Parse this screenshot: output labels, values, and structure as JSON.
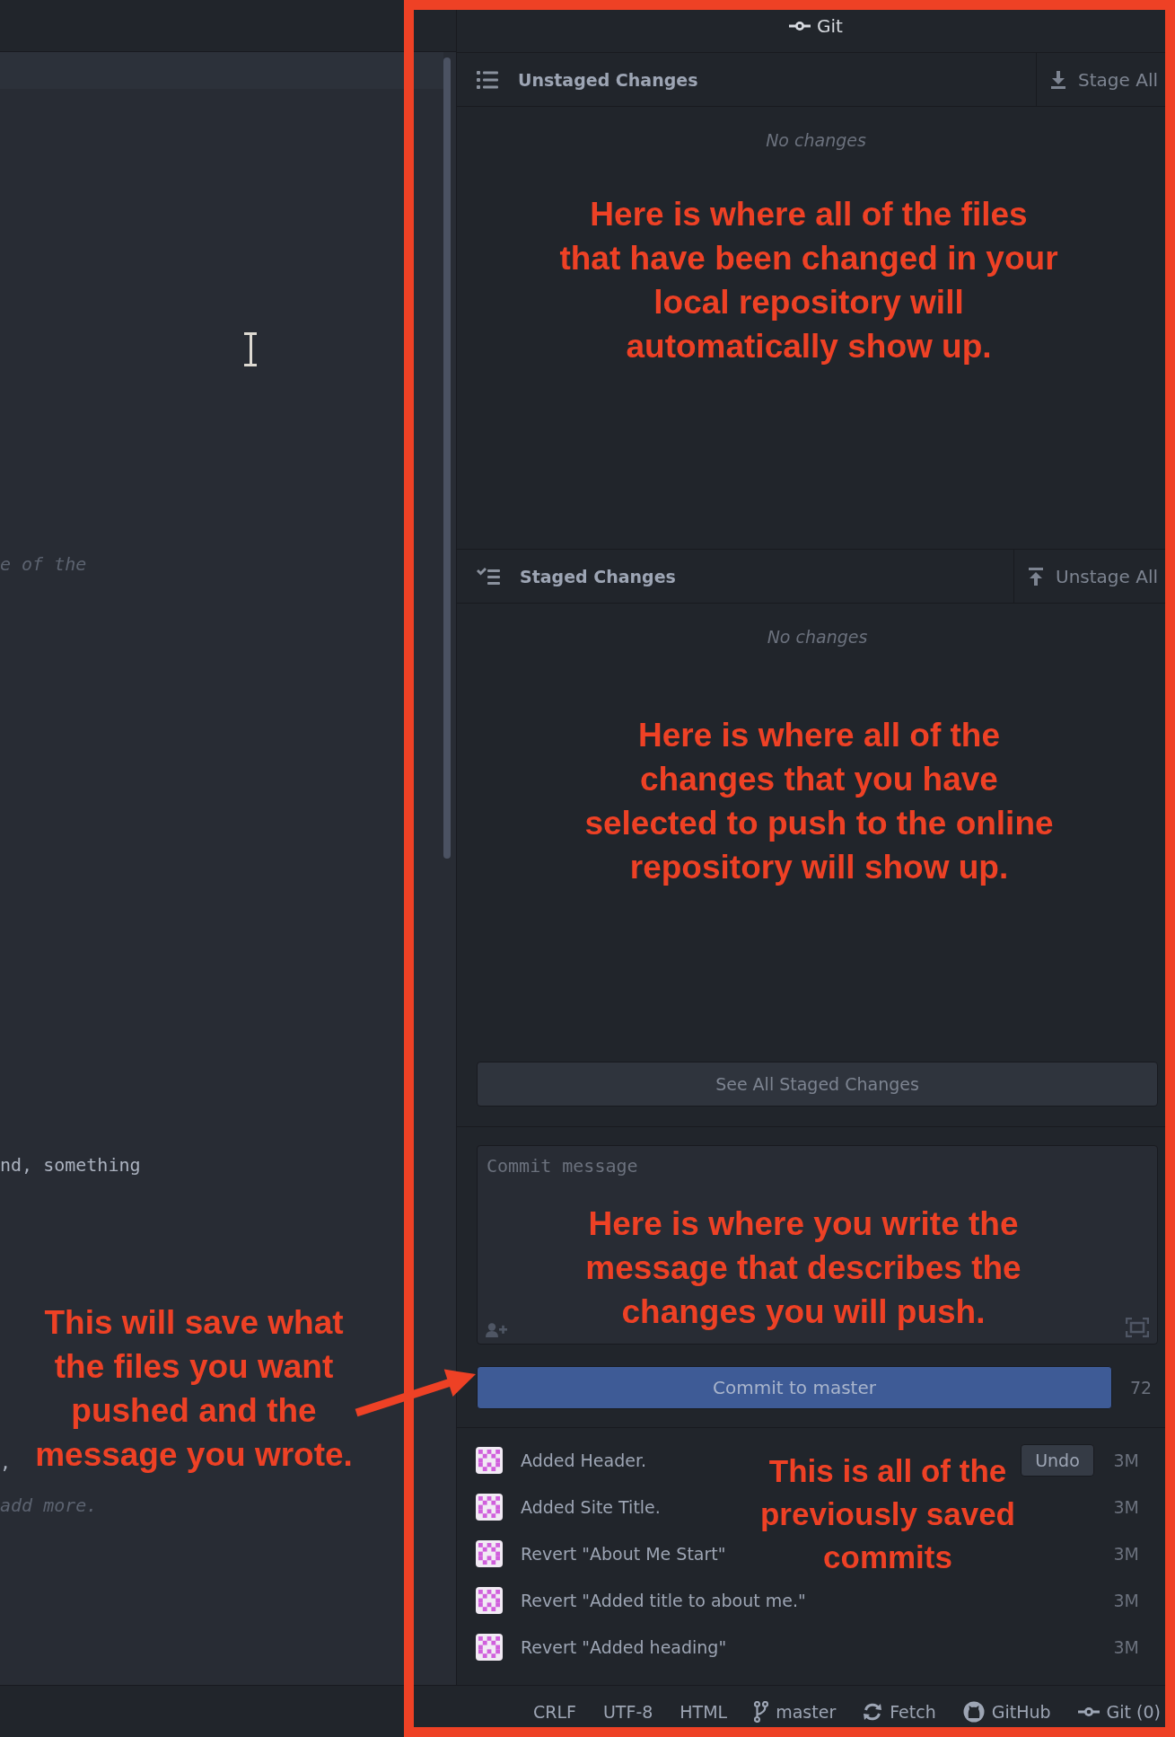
{
  "editor": {
    "lines": [
      {
        "text": "e of the",
        "kind": "comment"
      },
      {
        "text": "nd, something",
        "kind": "code"
      },
      {
        "text": ",",
        "kind": "code"
      },
      {
        "text": "add more.",
        "kind": "comment"
      }
    ]
  },
  "git_panel": {
    "title": "Git",
    "unstaged": {
      "title": "Unstaged Changes",
      "action": "Stage All",
      "empty_text": "No changes"
    },
    "staged": {
      "title": "Staged Changes",
      "action": "Unstage All",
      "empty_text": "No changes"
    },
    "see_all_button": "See All Staged Changes",
    "commit_message": {
      "placeholder": "Commit message"
    },
    "commit_button": "Commit to master",
    "remaining_chars": "72",
    "commits": [
      {
        "message": "Added Header.",
        "time": "3M",
        "undo": "Undo"
      },
      {
        "message": "Added Site Title.",
        "time": "3M"
      },
      {
        "message": "Revert \"About Me Start\"",
        "time": "3M"
      },
      {
        "message": "Revert \"Added title to about me.\"",
        "time": "3M"
      },
      {
        "message": "Revert \"Added heading\"",
        "time": "3M"
      }
    ]
  },
  "status_bar": {
    "items": [
      {
        "kind": "text",
        "label": "CRLF"
      },
      {
        "kind": "text",
        "label": "UTF-8"
      },
      {
        "kind": "text",
        "label": "HTML"
      },
      {
        "kind": "branch",
        "label": "master"
      },
      {
        "kind": "fetch",
        "label": "Fetch"
      },
      {
        "kind": "github",
        "label": "GitHub"
      },
      {
        "kind": "git",
        "label": "Git (0)"
      }
    ]
  },
  "annotations": [
    {
      "text": "Here is where all of the files that have been changed in your local repository will automatically show up."
    },
    {
      "text": "Here is where all of the changes that you have selected to push to the online repository will show up."
    },
    {
      "text": "Here is where you write the message that describes the changes you will push."
    },
    {
      "text": "This will save what the files you want pushed and the message you wrote."
    },
    {
      "text": "This is all of the previously saved commits"
    }
  ]
}
